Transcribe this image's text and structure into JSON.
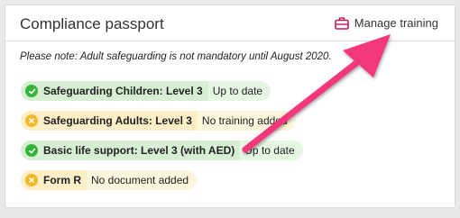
{
  "card": {
    "title": "Compliance passport",
    "manage_label": "Manage training",
    "manage_icon": "briefcase-icon",
    "note": "Please note: Adult safeguarding is not mandatory until August 2020."
  },
  "items": [
    {
      "label": "Safeguarding Children: Level 3",
      "status": "Up to date",
      "state": "green",
      "icon": "check-icon"
    },
    {
      "label": "Safeguarding Adults: Level 3",
      "status": "No training added",
      "state": "yellow",
      "icon": "cross-icon"
    },
    {
      "label": "Basic life support: Level 3 (with AED)",
      "status": "Up to date",
      "state": "green",
      "icon": "check-icon"
    },
    {
      "label": "Form R",
      "status": "No document added",
      "state": "yellow",
      "icon": "cross-icon"
    }
  ],
  "colors": {
    "accent": "#c2185b",
    "arrow": "#f2377a",
    "ok": "#36b43a",
    "warn": "#f0bb2a"
  }
}
